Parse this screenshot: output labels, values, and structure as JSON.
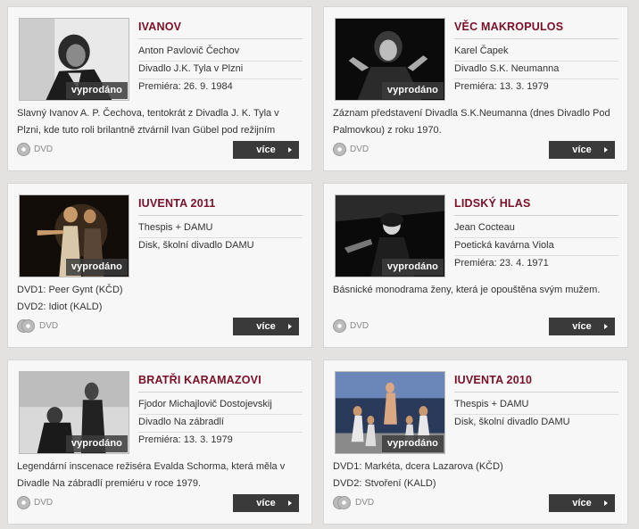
{
  "cards": [
    {
      "title": "IVANOV",
      "badge": "vyprodáno",
      "lines": [
        "Anton Pavlovič Čechov",
        "Divadlo J.K. Tyla v Plzni",
        "Premiéra: 26. 9. 1984"
      ],
      "desc": [
        "Slavný Ivanov A. P. Čechova, tentokrát z Divadla J. K. Tyla v",
        "Plzni, kde tuto roli brilantně ztvárnil Ivan Gübel pod režijním"
      ],
      "format": "DVD",
      "more": "více"
    },
    {
      "title": "VĚC MAKROPULOS",
      "badge": "vyprodáno",
      "lines": [
        "Karel Čapek",
        "Divadlo S.K. Neumanna",
        "Premiéra: 13. 3. 1979"
      ],
      "desc": [
        "Záznam představení Divadla S.K.Neumanna (dnes Divadlo Pod",
        "Palmovkou) z roku 1970."
      ],
      "format": "DVD",
      "more": "více"
    },
    {
      "title": "IUVENTA 2011",
      "badge": "vyprodáno",
      "lines": [
        "Thespis + DAMU",
        "Disk, školní divadlo DAMU"
      ],
      "desc": [
        "DVD1: Peer Gynt (KČD)",
        "DVD2: Idiot (KALD)"
      ],
      "format": "DVD",
      "more": "více"
    },
    {
      "title": "LIDSKÝ HLAS",
      "badge": "vyprodáno",
      "lines": [
        "Jean Cocteau",
        "Poetická kavárna Viola",
        "Premiéra: 23. 4. 1971"
      ],
      "desc": [
        "Básnické monodrama ženy, která je opouštěna svým mužem."
      ],
      "format": "DVD",
      "more": "více"
    },
    {
      "title": "BRATŘI KARAMAZOVI",
      "badge": "vyprodáno",
      "lines": [
        "Fjodor Michajlovič Dostojevskij",
        "Divadlo Na zábradlí",
        "Premiéra: 13. 3. 1979"
      ],
      "desc": [
        "Legendární inscenace režiséra Evalda Schorma, která měla v",
        "Divadle Na zábradlí premiéru v roce 1979."
      ],
      "format": "DVD",
      "more": "více"
    },
    {
      "title": "IUVENTA 2010",
      "badge": "vyprodáno",
      "lines": [
        "Thespis + DAMU",
        "Disk, školní divadlo DAMU"
      ],
      "desc": [
        "DVD1: Markéta, dcera Lazarova (KČD)",
        "DVD2: Stvoření (KALD)"
      ],
      "format": "DVD",
      "more": "více"
    }
  ],
  "colors": {
    "title": "#7a1028",
    "button": "#3a3a3a",
    "background": "#e4e2e1"
  },
  "icons": {
    "disc": "dvd-disc-icon",
    "arrow": "arrow-right-icon"
  }
}
